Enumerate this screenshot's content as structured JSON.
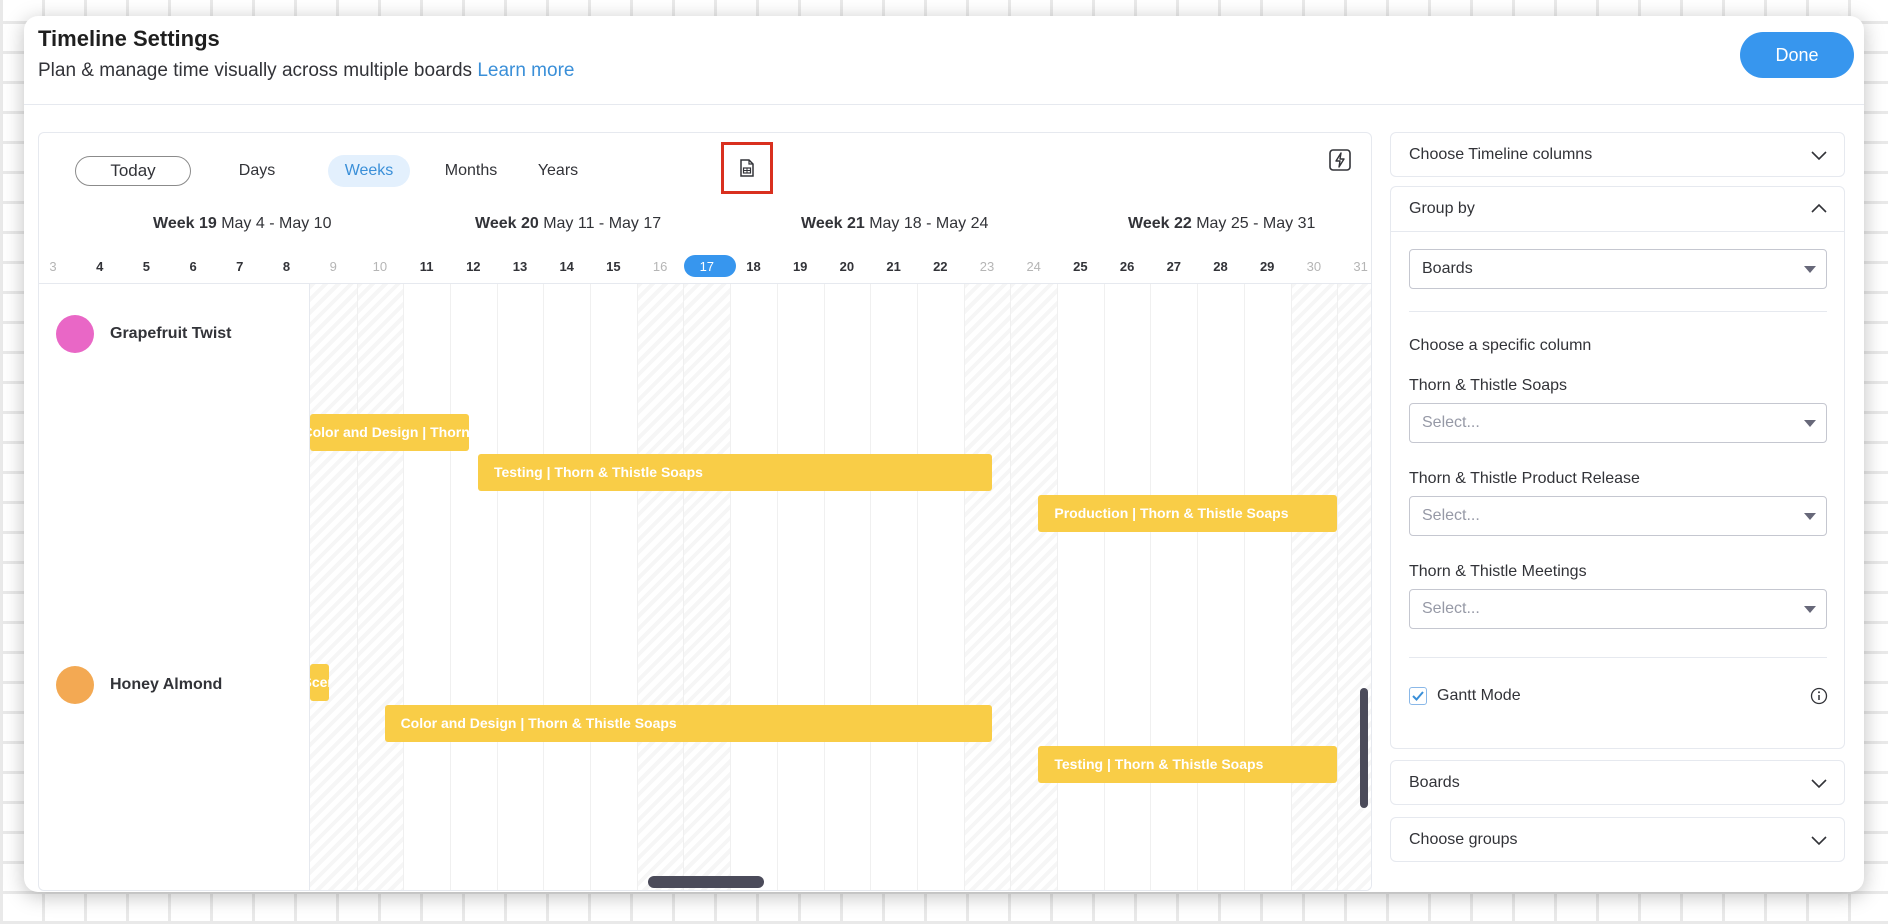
{
  "header": {
    "title": "Timeline Settings",
    "subtitle": "Plan & manage time visually across multiple boards",
    "learn_more": "Learn more",
    "done_label": "Done"
  },
  "toolbar": {
    "today_label": "Today",
    "zoom_options": [
      "Days",
      "Weeks",
      "Months",
      "Years"
    ],
    "active_zoom": "Weeks",
    "export_icon": "document-icon",
    "automation_icon": "lightning-icon"
  },
  "weeks": [
    {
      "label": "Week 19",
      "range": "May 4 - May 10"
    },
    {
      "label": "Week 20",
      "range": "May 11 - May 17"
    },
    {
      "label": "Week 21",
      "range": "May 18 - May 24"
    },
    {
      "label": "Week 22",
      "range": "May 25 - May 31"
    }
  ],
  "days": [
    "3",
    "4",
    "5",
    "6",
    "7",
    "8",
    "9",
    "10",
    "11",
    "12",
    "13",
    "14",
    "15",
    "16",
    "17",
    "18",
    "19",
    "20",
    "21",
    "22",
    "23",
    "24",
    "25",
    "26",
    "27",
    "28",
    "29",
    "30",
    "31"
  ],
  "today_day": "17",
  "weekend_days": [
    "3",
    "9",
    "10",
    "16",
    "17",
    "23",
    "24",
    "30",
    "31"
  ],
  "groups": [
    {
      "name": "Grapefruit Twist",
      "color": "#e967c6",
      "bars": [
        {
          "label": "Color and Design | Thorn & Thistle Soaps",
          "start": "8.5",
          "end": "12.4"
        },
        {
          "label": "Testing | Thorn & Thistle Soaps",
          "start": "12.6",
          "end": "23.6"
        },
        {
          "label": "Production | Thorn & Thistle Soaps",
          "start": "24.6",
          "end": "31"
        }
      ]
    },
    {
      "name": "Honey Almond",
      "color": "#f3a953",
      "bars": [
        {
          "label": "Scent Design | Thorn & Thistle Soaps",
          "start": "8.5",
          "end": "9.4"
        },
        {
          "label": "Color and Design | Thorn & Thistle Soaps",
          "start": "10.6",
          "end": "23.6"
        },
        {
          "label": "Testing | Thorn & Thistle Soaps",
          "start": "24.6",
          "end": "31"
        }
      ]
    }
  ],
  "sidebar": {
    "choose_columns": "Choose Timeline columns",
    "group_by": "Group by",
    "group_by_value": "Boards",
    "choose_specific_column": "Choose a specific column",
    "board_columns": [
      {
        "board": "Thorn & Thistle Soaps",
        "placeholder": "Select..."
      },
      {
        "board": "Thorn & Thistle Product Release",
        "placeholder": "Select..."
      },
      {
        "board": "Thorn & Thistle Meetings",
        "placeholder": "Select..."
      }
    ],
    "gantt_mode": "Gantt Mode",
    "gantt_checked": true,
    "boards": "Boards",
    "choose_groups": "Choose groups"
  },
  "colors": {
    "accent": "#3796ee",
    "bar": "#f9cd47",
    "highlight": "#d9301f"
  }
}
